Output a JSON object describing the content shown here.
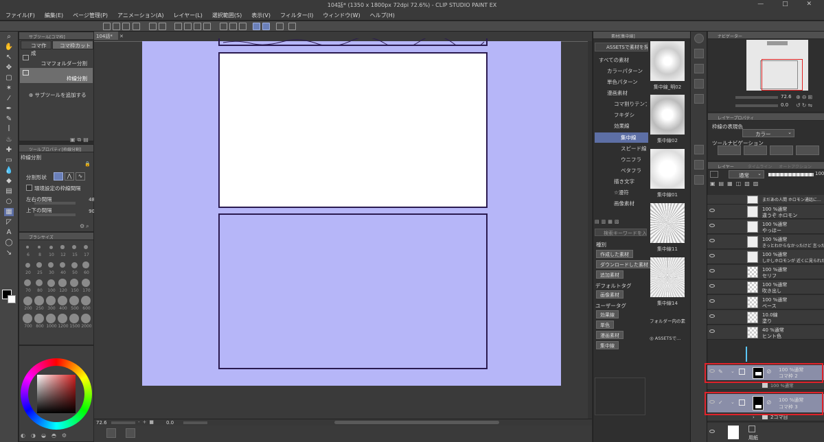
{
  "window": {
    "title": "104話* (1350 x 1800px 72dpi 72.6%) - CLIP STUDIO PAINT EX",
    "controls": "— □ ✕"
  },
  "menu": [
    "ファイル(F)",
    "編集(E)",
    "ページ管理(P)",
    "アニメーション(A)",
    "レイヤー(L)",
    "選択範囲(S)",
    "表示(V)",
    "フィルター(I)",
    "ウィンドウ(W)",
    "ヘルプ(H)"
  ],
  "canvas_tab": "104話*",
  "subtool": {
    "header": "サブツール[コマ枠]",
    "tabs": [
      "コマ作成",
      "コマ枠カット"
    ],
    "items": [
      "コマフォルダー分割",
      "枠線分割"
    ],
    "add_label": "サブツールを追加する"
  },
  "toolprop": {
    "header": "ツールプロパティ[枠線分割]",
    "title": "枠線分割",
    "shape_label": "分割形状",
    "checkbox_label": "環境設定の枠線間隔",
    "h_gap_label": "左右の間隔",
    "h_gap_value": "48",
    "v_gap_label": "上下の間隔",
    "v_gap_value": "90"
  },
  "brushsize": {
    "header": "ブラシサイズ",
    "sizes": [
      "6",
      "8",
      "10",
      "12",
      "15",
      "17",
      "20",
      "25",
      "30",
      "40",
      "50",
      "60",
      "70",
      "80",
      "100",
      "120",
      "150",
      "170",
      "200",
      "250",
      "300",
      "400",
      "500",
      "600",
      "700",
      "800",
      "1000",
      "1200",
      "1500",
      "2000"
    ]
  },
  "statusbar": {
    "zoom": "72.6",
    "angle": "0.0"
  },
  "material": {
    "header": "素材[集中線]",
    "assets_btn": "ASSETSで素材を探す",
    "tree": [
      "すべての素材",
      "カラーパターン",
      "単色パターン",
      "漫画素材",
      "コマ割りテンプレート",
      "フキダシ",
      "効果線",
      "集中線",
      "スピード線",
      "ウニフラ",
      "ベタフラ",
      "描き文字",
      "☆漫符",
      "画像素材"
    ],
    "search_placeholder": "検索キーワードを入力",
    "type_label": "種別",
    "type_tags": [
      "作成した素材",
      "ダウンロードした素材",
      "追加素材"
    ],
    "default_tag_label": "デフォルトタグ",
    "default_tags": [
      "画像素材"
    ],
    "user_tag_label": "ユーザータグ",
    "user_tags": [
      "効果線",
      "単色",
      "漫画素材",
      "集中線"
    ],
    "thumbs": [
      "集中線_明02",
      "集中線02",
      "集中線01",
      "集中線11",
      "集中線14"
    ],
    "folder_note": "フォルダー内の素材",
    "assets_small": "ASSETSで..."
  },
  "navigator": {
    "header": "ナビゲーター",
    "zoom": "72.6",
    "angle": "0.0"
  },
  "layerprop": {
    "header": "レイヤープロパティ",
    "color_label": "枠線の表現色",
    "color_value": "カラー",
    "nav_label": "ツールナビゲーション"
  },
  "layers": {
    "header": "レイヤー",
    "tabs": [
      "レイヤー",
      "タイムライン",
      "オートアクション"
    ],
    "blend_mode": "通常",
    "opacity": "100",
    "rows": [
      {
        "line1": "まだあの人間 ホロモン通話に…",
        "line2": ""
      },
      {
        "line1": "100 %通常",
        "line2": "違うぞ ホロモン"
      },
      {
        "line1": "100 %通常",
        "line2": "やっほー"
      },
      {
        "line1": "100 %通常",
        "line2": "きっとわからなかったけど 言ったか"
      },
      {
        "line1": "100 %通常",
        "line2": "しかしホロモンが 近くに見られた…"
      },
      {
        "line1": "100 %通常",
        "line2": "セリフ"
      },
      {
        "line1": "100 %通常",
        "line2": "吹き出し"
      },
      {
        "line1": "100 %通常",
        "line2": "ベース"
      },
      {
        "line1": "10.0線",
        "line2": "塗り"
      },
      {
        "line1": "40 %通常",
        "line2": "ヒント色"
      },
      {
        "line1": "100 %通常",
        "line2": "コマ枠 2"
      },
      {
        "line1": "100 %通常",
        "line2": ""
      },
      {
        "line1": "100 %通常",
        "line2": "コマ枠 3"
      },
      {
        "line1": "",
        "line2": "2コマ目"
      },
      {
        "line1": "",
        "line2": "用紙"
      }
    ]
  }
}
